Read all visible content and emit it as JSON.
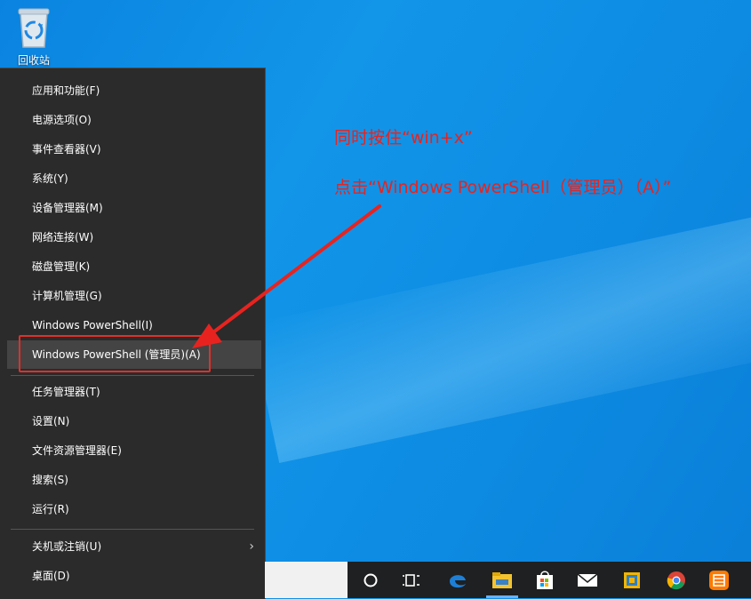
{
  "desktop": {
    "recycle_bin_label": "回收站"
  },
  "menu": {
    "items": [
      {
        "label": "应用和功能(F)"
      },
      {
        "label": "电源选项(O)"
      },
      {
        "label": "事件查看器(V)"
      },
      {
        "label": "系统(Y)"
      },
      {
        "label": "设备管理器(M)"
      },
      {
        "label": "网络连接(W)"
      },
      {
        "label": "磁盘管理(K)"
      },
      {
        "label": "计算机管理(G)"
      },
      {
        "label": "Windows PowerShell(I)"
      },
      {
        "label": "Windows PowerShell (管理员)(A)"
      },
      {
        "label": "任务管理器(T)"
      },
      {
        "label": "设置(N)"
      },
      {
        "label": "文件资源管理器(E)"
      },
      {
        "label": "搜索(S)"
      },
      {
        "label": "运行(R)"
      },
      {
        "label": "关机或注销(U)"
      },
      {
        "label": "桌面(D)"
      }
    ],
    "submenu_chevron": "›"
  },
  "annotations": {
    "line1": "同时按住“win+x”",
    "line2": "点击“Windows PowerShell（管理员）（A）”",
    "color": "#e8231f"
  },
  "taskbar": {
    "icons": [
      "cortana-circle-icon",
      "task-view-icon",
      "edge-icon",
      "file-explorer-icon",
      "store-icon",
      "mail-icon",
      "app-icon",
      "chrome-icon",
      "app-orange-icon"
    ],
    "accent": "#6ab0ff"
  }
}
